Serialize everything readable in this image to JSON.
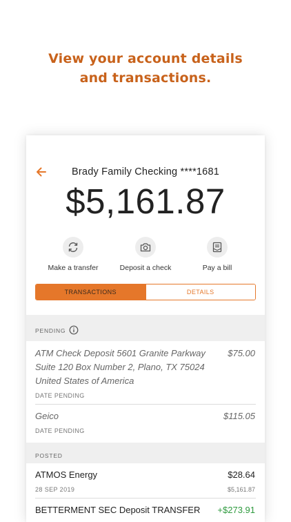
{
  "promo": {
    "line1": "View your account details",
    "line2": "and transactions."
  },
  "header": {
    "back_icon": "arrow-left-icon",
    "account_title": "Brady Family Checking ****1681",
    "balance": "$5,161.87"
  },
  "actions": [
    {
      "label": "Make a transfer",
      "icon": "refresh-arrows-icon"
    },
    {
      "label": "Deposit a check",
      "icon": "camera-icon"
    },
    {
      "label": "Pay a bill",
      "icon": "bill-icon"
    }
  ],
  "tabs": {
    "transactions": "TRANSACTIONS",
    "details": "DETAILS",
    "selected": "transactions"
  },
  "pending": {
    "header": "PENDING",
    "info_icon": "info-icon",
    "items": [
      {
        "desc_lines": [
          "ATM Check Deposit 5601 Granite Parkway",
          "Suite 120 Box Number 2, Plano, TX 75024",
          "United States of America"
        ],
        "amount": "$75.00",
        "status": "DATE PENDING"
      },
      {
        "desc_lines": [
          "Geico"
        ],
        "amount": "$115.05",
        "status": "DATE PENDING"
      }
    ]
  },
  "posted": {
    "header": "POSTED",
    "items": [
      {
        "desc": "ATMOS Energy",
        "amount": "$28.64",
        "date": "28 SEP 2019",
        "running_balance": "$5,161.87"
      },
      {
        "desc": "BETTERMENT SEC Deposit TRANSFER",
        "amount": "+$273.91"
      }
    ]
  },
  "colors": {
    "accent": "#e5772a",
    "promo_text": "#c8621b",
    "credit": "#2e9a3e",
    "section_bg": "#efefef"
  }
}
